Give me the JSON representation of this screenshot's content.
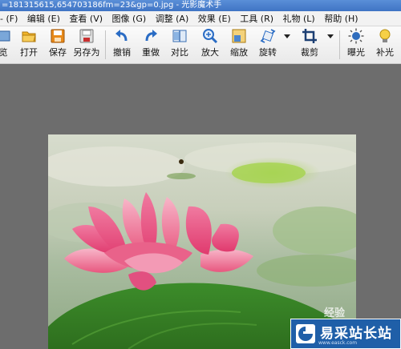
{
  "window": {
    "title": "=181315615,654703186fm=23&gp=0.jpg - 光影魔术手"
  },
  "menu": {
    "items": [
      {
        "label": "- (F)",
        "partial": true
      },
      {
        "label": "编辑 (E)"
      },
      {
        "label": "查看 (V)"
      },
      {
        "label": "图像 (G)"
      },
      {
        "label": "调整 (A)"
      },
      {
        "label": "效果 (E)"
      },
      {
        "label": "工具 (R)"
      },
      {
        "label": "礼物 (L)"
      },
      {
        "label": "帮助 (H)"
      }
    ]
  },
  "toolbar": {
    "items": [
      {
        "label": "览",
        "icon": "browse-icon"
      },
      {
        "label": "打开",
        "icon": "folder-open-icon"
      },
      {
        "label": "保存",
        "icon": "save-icon"
      },
      {
        "label": "另存为",
        "icon": "save-as-icon"
      },
      {
        "label": "撤销",
        "icon": "undo-icon"
      },
      {
        "label": "重做",
        "icon": "redo-icon"
      },
      {
        "label": "对比",
        "icon": "compare-icon"
      },
      {
        "label": "放大",
        "icon": "zoom-in-icon"
      },
      {
        "label": "缩放",
        "icon": "resize-icon"
      },
      {
        "label": "旋转",
        "icon": "rotate-icon"
      },
      {
        "label": "裁剪",
        "icon": "crop-icon"
      },
      {
        "label": "曝光",
        "icon": "exposure-icon"
      },
      {
        "label": "补光",
        "icon": "fill-light-icon"
      }
    ]
  },
  "photo": {
    "description_icon": "lotus-photo"
  },
  "watermark": {
    "site": "易采站长站",
    "url": "www.easck.com",
    "overlay": "经验"
  },
  "colors": {
    "title_bar": "#4a82d0",
    "canvas_bg": "#6d6d6d",
    "watermark_bg": "#1f5fa8",
    "undo_blue": "#2a6cc4",
    "folder_yellow": "#f0b429"
  }
}
